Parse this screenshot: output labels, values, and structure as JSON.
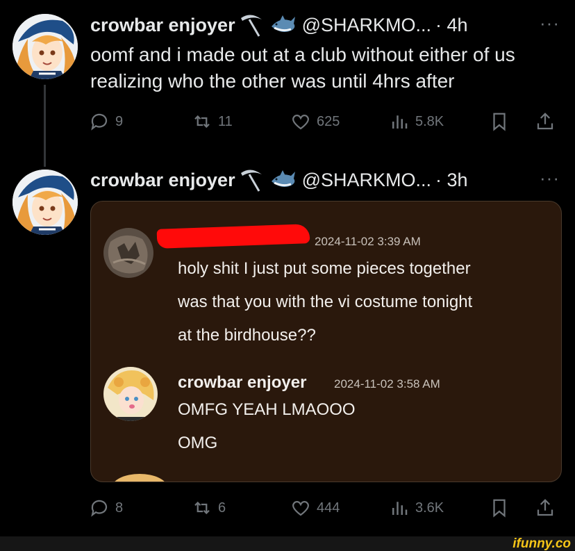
{
  "tweets": [
    {
      "display_name": "crowbar enjoyer",
      "handle": "@SHARKMO...",
      "time": "· 4h",
      "more": "···",
      "text": "oomf and i made out at a club without either of us realizing who the other was until 4hrs after",
      "replies": "9",
      "retweets": "11",
      "likes": "625",
      "views": "5.8K"
    },
    {
      "display_name": "crowbar enjoyer",
      "handle": "@SHARKMO...",
      "time": "· 3h",
      "more": "···",
      "replies": "8",
      "retweets": "6",
      "likes": "444",
      "views": "3.6K",
      "embedded_chat": {
        "messages": [
          {
            "author": "",
            "timestamp": "2024-11-02 3:39 AM",
            "lines": [
              "holy shit I just put some pieces together",
              "was that you with the vi costume tonight",
              "at the birdhouse??"
            ]
          },
          {
            "author": "crowbar enjoyer",
            "timestamp": "2024-11-02 3:58 AM",
            "lines": [
              "OMFG YEAH LMAOOO",
              "OMG"
            ]
          }
        ]
      }
    }
  ],
  "icons": {
    "reply": "reply-icon",
    "retweet": "retweet-icon",
    "like": "heart-icon",
    "views": "views-icon",
    "bookmark": "bookmark-icon",
    "share": "share-icon",
    "pickaxe": "pickaxe-icon",
    "shark": "shark-icon"
  },
  "colors": {
    "background": "#000000",
    "text": "#e7e9ea",
    "muted": "#71767b",
    "chat_background": "#2a180c",
    "redaction": "#ff0a0a",
    "watermark": "#f5c518"
  },
  "watermark": "ifunny.co"
}
